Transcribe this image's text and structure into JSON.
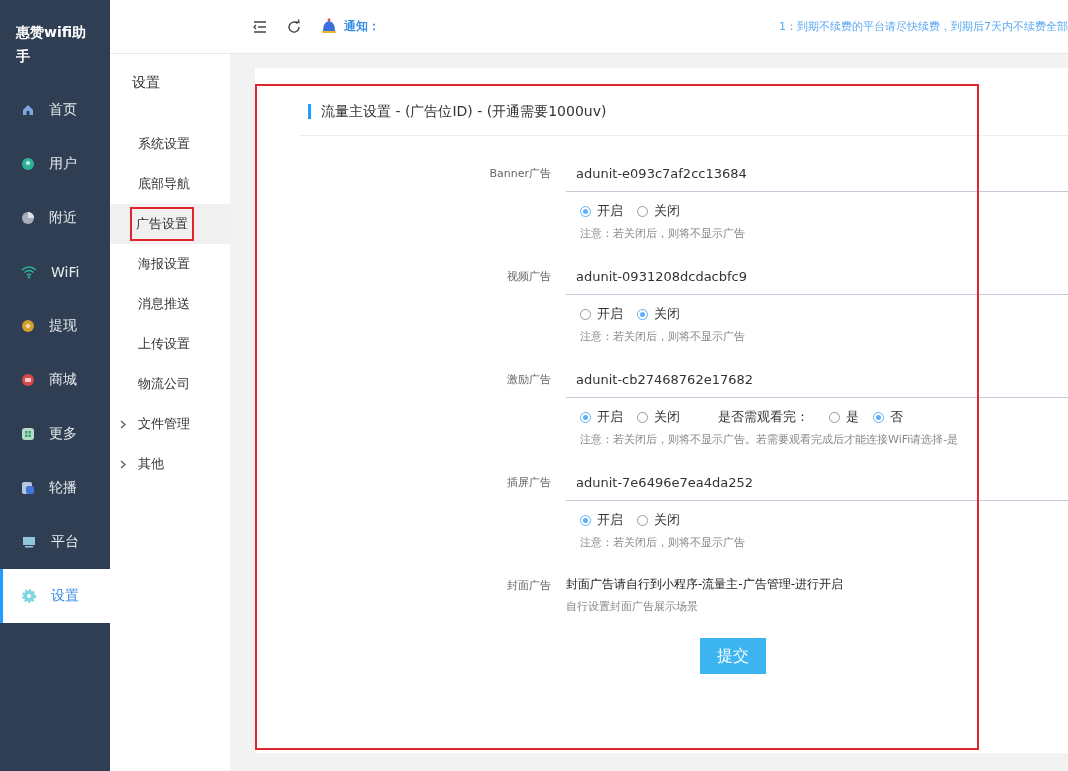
{
  "app_title": "惠赞wifi助手",
  "nav": [
    {
      "label": "首页",
      "selected": false
    },
    {
      "label": "用户",
      "selected": false
    },
    {
      "label": "附近",
      "selected": false
    },
    {
      "label": "WiFi",
      "selected": false
    },
    {
      "label": "提现",
      "selected": false
    },
    {
      "label": "商城",
      "selected": false
    },
    {
      "label": "更多",
      "selected": false
    },
    {
      "label": "轮播",
      "selected": false
    },
    {
      "label": "平台",
      "selected": false
    },
    {
      "label": "设置",
      "selected": true
    }
  ],
  "submenu": {
    "title": "设置",
    "items": [
      {
        "label": "系统设置",
        "selected": false,
        "expandable": false,
        "outlined": false
      },
      {
        "label": "底部导航",
        "selected": false,
        "expandable": false,
        "outlined": false
      },
      {
        "label": "广告设置",
        "selected": true,
        "expandable": false,
        "outlined": true
      },
      {
        "label": "海报设置",
        "selected": false,
        "expandable": false,
        "outlined": false
      },
      {
        "label": "消息推送",
        "selected": false,
        "expandable": false,
        "outlined": false
      },
      {
        "label": "上传设置",
        "selected": false,
        "expandable": false,
        "outlined": false
      },
      {
        "label": "物流公司",
        "selected": false,
        "expandable": false,
        "outlined": false
      },
      {
        "label": "文件管理",
        "selected": false,
        "expandable": true,
        "outlined": false
      },
      {
        "label": "其他",
        "selected": false,
        "expandable": true,
        "outlined": false
      }
    ]
  },
  "notice": {
    "label": "通知：",
    "text": "1：到期不续费的平台请尽快续费，到期后7天内不续费全部"
  },
  "form": {
    "title": "流量主设置 - (广告位ID) - (开通需要1000uv)",
    "outlined": true,
    "ads": [
      {
        "kind": "input",
        "label": "Banner广告",
        "value": "adunit-e093c7af2cc13684",
        "options": [
          {
            "label": "开启",
            "selected": true
          },
          {
            "label": "关闭",
            "selected": false
          }
        ],
        "note": "注意：若关闭后，则将不显示广告"
      },
      {
        "kind": "input",
        "label": "视频广告",
        "value": "adunit-0931208dcdacbfc9",
        "options": [
          {
            "label": "开启",
            "selected": false
          },
          {
            "label": "关闭",
            "selected": true
          }
        ],
        "note": "注意：若关闭后，则将不显示广告"
      },
      {
        "kind": "input",
        "label": "激励广告",
        "value": "adunit-cb27468762e17682",
        "options": [
          {
            "label": "开启",
            "selected": true
          },
          {
            "label": "关闭",
            "selected": false
          }
        ],
        "extra": {
          "label": "是否需观看完：",
          "options": [
            {
              "label": "是",
              "selected": false
            },
            {
              "label": "否",
              "selected": true
            }
          ]
        },
        "note": "注意：若关闭后，则将不显示广告。若需要观看完成后才能连接WiFi请选择-是"
      },
      {
        "kind": "input",
        "label": "插屏广告",
        "value": "adunit-7e6496e7ea4da252",
        "options": [
          {
            "label": "开启",
            "selected": true
          },
          {
            "label": "关闭",
            "selected": false
          }
        ],
        "note": "注意：若关闭后，则将不显示广告"
      },
      {
        "kind": "text",
        "label": "封面广告",
        "text": "封面广告请自行到小程序-流量主-广告管理-进行开启",
        "note": "自行设置封面广告展示场景"
      }
    ],
    "submit": "提交"
  }
}
